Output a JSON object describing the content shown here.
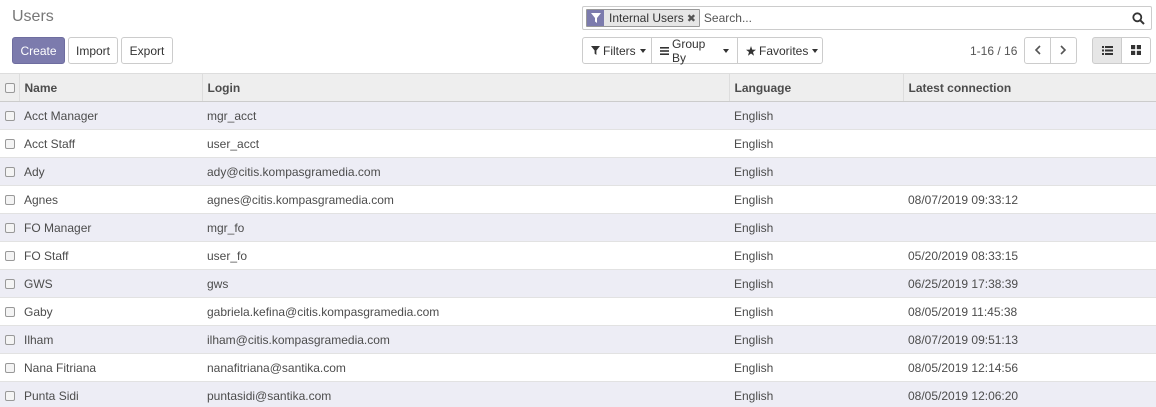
{
  "page": {
    "title": "Users"
  },
  "toolbar": {
    "create_label": "Create",
    "import_label": "Import",
    "export_label": "Export"
  },
  "search": {
    "facet_value": "Internal Users",
    "facet_remove": "✖",
    "placeholder": "Search..."
  },
  "filters": {
    "filters_label": "Filters",
    "group_by_label": "Group By",
    "favorites_label": "Favorites"
  },
  "pager": {
    "value": "1-16 / 16"
  },
  "colors": {
    "primary": "#7c7bad",
    "row_alt": "#ededf5",
    "header_bg": "#eeeeee"
  },
  "icons": {
    "filter_facet": "funnel-icon",
    "search": "search-icon",
    "filters": "filter-icon",
    "group_by": "bars-icon",
    "favorites": "star-icon",
    "prev": "chevron-left-icon",
    "next": "chevron-right-icon",
    "list_view": "list-view-icon",
    "kanban_view": "kanban-view-icon"
  },
  "table": {
    "columns": [
      "Name",
      "Login",
      "Language",
      "Latest connection"
    ],
    "rows": [
      {
        "name": "Acct Manager",
        "login": "mgr_acct",
        "language": "English",
        "latest": ""
      },
      {
        "name": "Acct Staff",
        "login": "user_acct",
        "language": "English",
        "latest": ""
      },
      {
        "name": "Ady",
        "login": "ady@citis.kompasgramedia.com",
        "language": "English",
        "latest": ""
      },
      {
        "name": "Agnes",
        "login": "agnes@citis.kompasgramedia.com",
        "language": "English",
        "latest": "08/07/2019 09:33:12"
      },
      {
        "name": "FO Manager",
        "login": "mgr_fo",
        "language": "English",
        "latest": ""
      },
      {
        "name": "FO Staff",
        "login": "user_fo",
        "language": "English",
        "latest": "05/20/2019 08:33:15"
      },
      {
        "name": "GWS",
        "login": "gws",
        "language": "English",
        "latest": "06/25/2019 17:38:39"
      },
      {
        "name": "Gaby",
        "login": "gabriela.kefina@citis.kompasgramedia.com",
        "language": "English",
        "latest": "08/05/2019 11:45:38"
      },
      {
        "name": "Ilham",
        "login": "ilham@citis.kompasgramedia.com",
        "language": "English",
        "latest": "08/07/2019 09:51:13"
      },
      {
        "name": "Nana Fitriana",
        "login": "nanafitriana@santika.com",
        "language": "English",
        "latest": "08/05/2019 12:14:56"
      },
      {
        "name": "Punta Sidi",
        "login": "puntasidi@santika.com",
        "language": "English",
        "latest": "08/05/2019 12:06:20"
      }
    ]
  }
}
